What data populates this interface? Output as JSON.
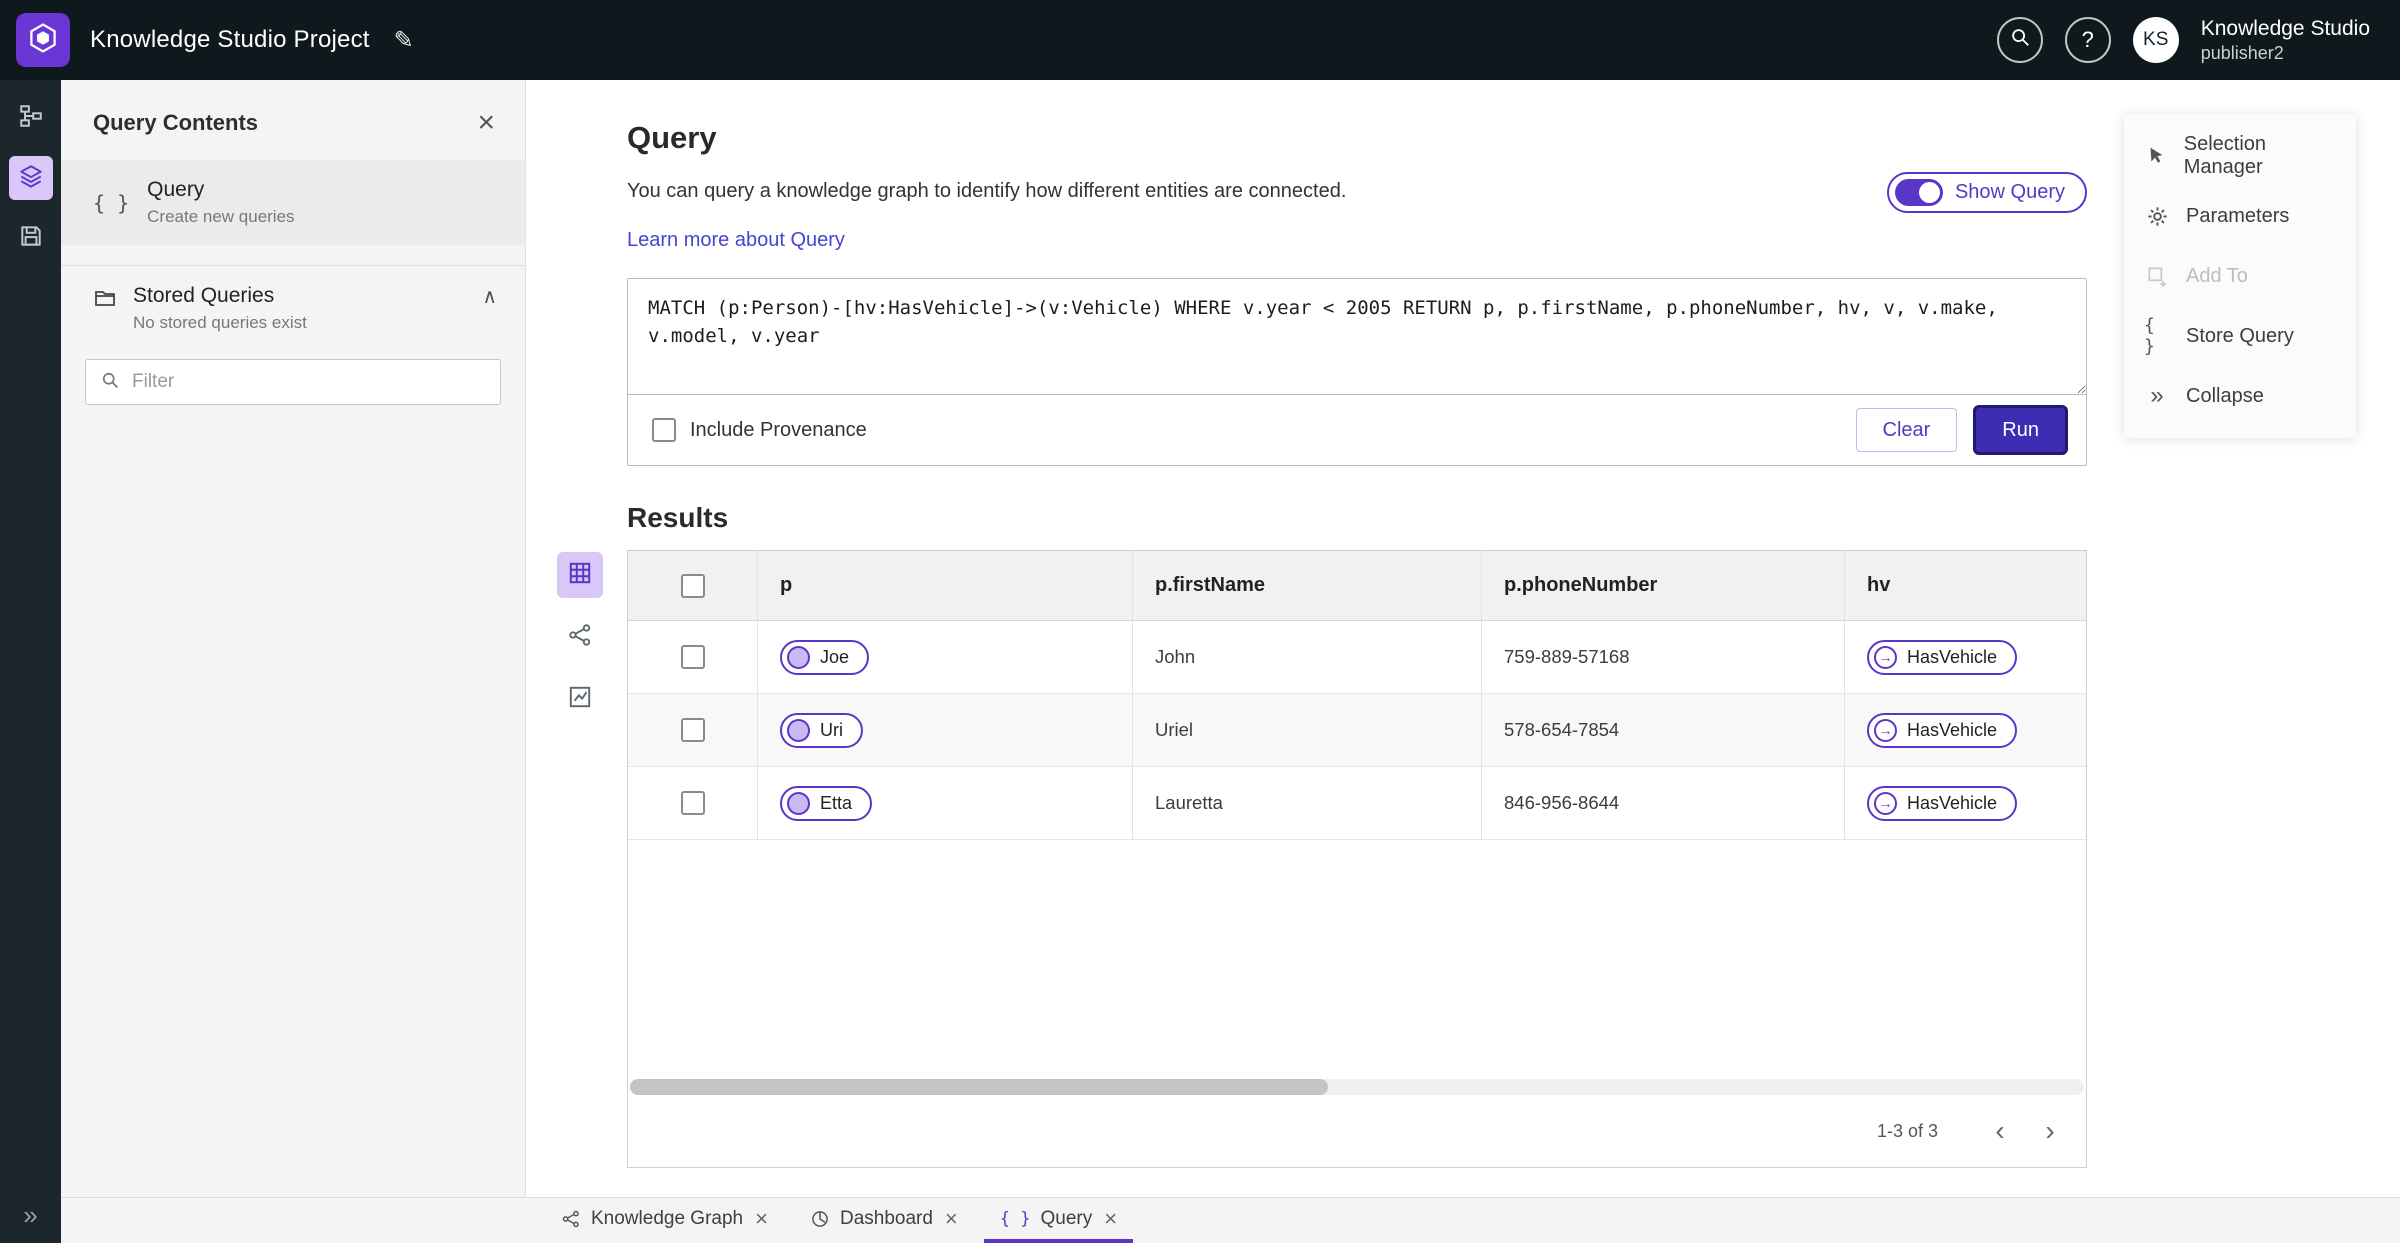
{
  "icons": {
    "close": "×",
    "edit": "✎",
    "collapse": "»",
    "chevron_left": "‹",
    "chevron_right": "›",
    "chevron_up": "∧",
    "edge_arrow": "→",
    "braces": "{ }",
    "help": "?"
  },
  "colors": {
    "primary_purple": "#5B35C8",
    "run_button": "#3E2DB2",
    "topbar_bg": "#0F191D",
    "rail_bg": "#1C262D",
    "panel_bg": "#F4F4F4",
    "link": "#4545D2",
    "selected_light_purple": "#D9C7F7"
  },
  "topbar": {
    "title": "Knowledge Studio Project",
    "product": "Knowledge Studio",
    "user": "publisher2",
    "avatar": "KS"
  },
  "left_panel": {
    "title": "Query Contents",
    "query_item": {
      "title": "Query",
      "subtitle": "Create new queries"
    },
    "stored": {
      "title": "Stored Queries",
      "subtitle": "No stored queries exist"
    },
    "filter_placeholder": "Filter"
  },
  "query": {
    "title": "Query",
    "description": "You can query a knowledge graph to identify how different entities are connected.",
    "learn_more": "Learn more about Query",
    "show_query_label": "Show Query",
    "query_text": "MATCH (p:Person)-[hv:HasVehicle]->(v:Vehicle) WHERE v.year < 2005 RETURN p, p.firstName, p.phoneNumber, hv, v, v.make, v.model, v.year",
    "include_provenance_label": "Include Provenance",
    "clear_label": "Clear",
    "run_label": "Run"
  },
  "results": {
    "title": "Results",
    "columns": [
      "p",
      "p.firstName",
      "p.phoneNumber",
      "hv"
    ],
    "rows": [
      {
        "p": "Joe",
        "firstName": "John",
        "phone": "759-889-57168",
        "hv": "HasVehicle"
      },
      {
        "p": "Uri",
        "firstName": "Uriel",
        "phone": "578-654-7854",
        "hv": "HasVehicle"
      },
      {
        "p": "Etta",
        "firstName": "Lauretta",
        "phone": "846-956-8644",
        "hv": "HasVehicle"
      }
    ],
    "pagination": "1-3 of 3"
  },
  "right_panel": {
    "items": [
      {
        "label": "Selection Manager",
        "disabled": false
      },
      {
        "label": "Parameters",
        "disabled": false
      },
      {
        "label": "Add To",
        "disabled": true
      },
      {
        "label": "Store Query",
        "disabled": false
      },
      {
        "label": "Collapse",
        "disabled": false
      }
    ]
  },
  "tabs": [
    {
      "label": "Knowledge Graph"
    },
    {
      "label": "Dashboard"
    },
    {
      "label": "Query"
    }
  ]
}
